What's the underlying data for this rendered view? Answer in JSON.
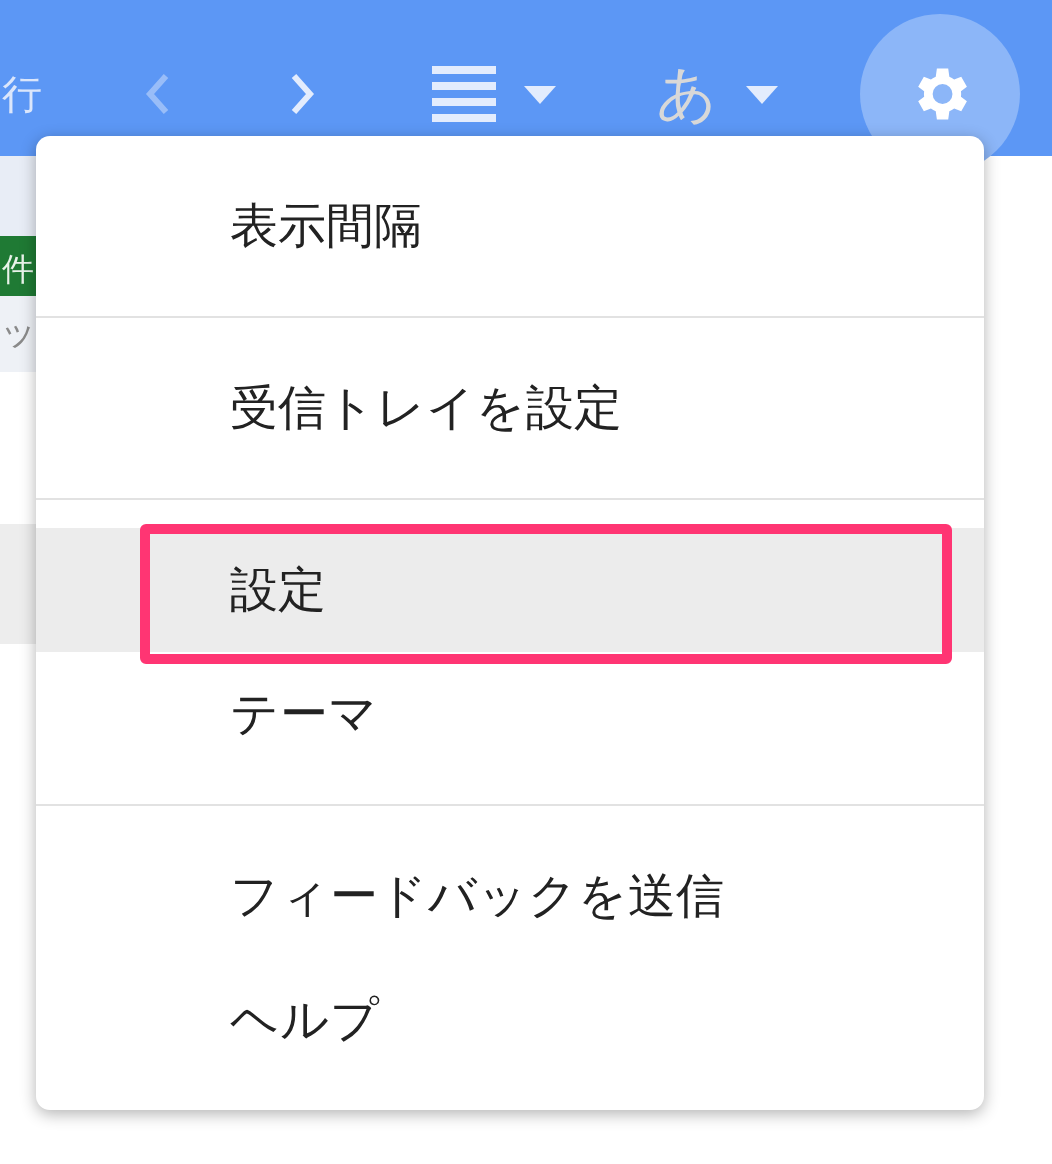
{
  "topbar": {
    "partial_label": "行",
    "nav": [
      {
        "kind": "back",
        "disabled": true
      },
      {
        "kind": "forward",
        "disabled": false
      }
    ],
    "input_tool": {
      "label": "あ"
    }
  },
  "page": {
    "badge": "件",
    "row_text": "ッ"
  },
  "menu": {
    "sections": [
      {
        "items": [
          {
            "label": "表示間隔",
            "selected": false,
            "framed": false
          }
        ]
      },
      {
        "items": [
          {
            "label": "受信トレイを設定",
            "selected": false,
            "framed": false
          }
        ]
      },
      {
        "items": [
          {
            "label": "設定",
            "selected": true,
            "framed": true
          },
          {
            "label": "テーマ",
            "selected": false,
            "framed": false
          }
        ]
      },
      {
        "items": [
          {
            "label": "フィードバックを送信",
            "selected": false,
            "framed": false
          },
          {
            "label": "ヘルプ",
            "selected": false,
            "framed": false
          }
        ]
      }
    ]
  }
}
